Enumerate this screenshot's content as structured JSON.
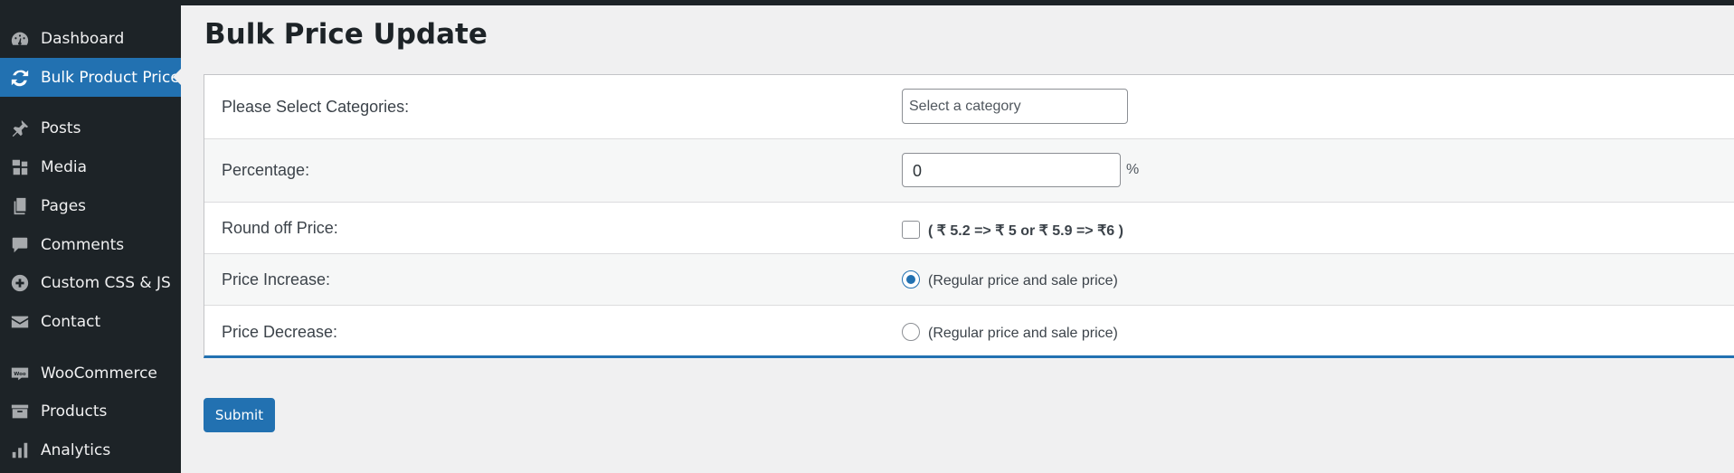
{
  "sidebar": {
    "items": [
      {
        "label": "Dashboard",
        "icon": "dashboard-icon"
      },
      {
        "label": "Bulk Product Price",
        "icon": "refresh-icon",
        "active": true
      },
      {
        "label": "Posts",
        "icon": "pin-icon"
      },
      {
        "label": "Media",
        "icon": "media-icon"
      },
      {
        "label": "Pages",
        "icon": "pages-icon"
      },
      {
        "label": "Comments",
        "icon": "comment-icon"
      },
      {
        "label": "Custom CSS & JS",
        "icon": "plus-circle-icon"
      },
      {
        "label": "Contact",
        "icon": "envelope-icon"
      },
      {
        "label": "WooCommerce",
        "icon": "woocommerce-icon",
        "icon_text": "Woo"
      },
      {
        "label": "Products",
        "icon": "archive-icon"
      },
      {
        "label": "Analytics",
        "icon": "bar-chart-icon"
      }
    ]
  },
  "page": {
    "title": "Bulk Price Update"
  },
  "form": {
    "categories": {
      "label": "Please Select Categories:",
      "placeholder": "Select a category"
    },
    "percentage": {
      "label": "Percentage:",
      "value": "0",
      "unit": "%"
    },
    "round_off": {
      "label": "Round off Price:",
      "checked": false,
      "note": "( ₹ 5.2 => ₹ 5 or ₹ 5.9 => ₹6 )"
    },
    "price_increase": {
      "label": "Price Increase:",
      "checked": true,
      "note": "(Regular price and sale price)"
    },
    "price_decrease": {
      "label": "Price Decrease:",
      "checked": false,
      "note": "(Regular price and sale price)"
    }
  },
  "submit_label": "Submit",
  "colors": {
    "sidebar_bg": "#1d2327",
    "accent": "#2271b1",
    "page_bg": "#f0f0f1"
  }
}
